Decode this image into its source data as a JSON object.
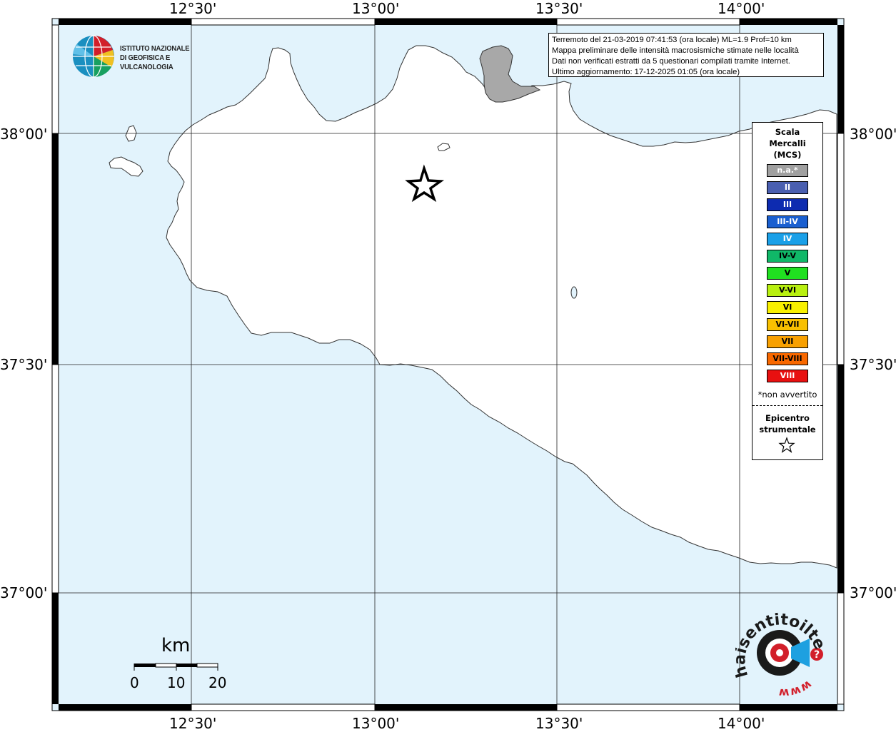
{
  "header": {
    "lines": [
      "Terremoto del 21-03-2019 07:41:53 (ora locale) ML=1.9 Prof=10 km",
      "Mappa preliminare delle intensità macrosismiche stimate nelle località",
      "Dati non verificati estratti da 5 questionari compilati tramite Internet.",
      "Ultimo aggiornamento: 17-12-2025 01:05 (ora locale)"
    ]
  },
  "logo": {
    "line1": "ISTITUTO NAZIONALE",
    "line2": "DI GEOFISICA E VULCANOLOGIA"
  },
  "axes": {
    "lon_labels": [
      "12°30'",
      "13°00'",
      "13°30'",
      "14°00'"
    ],
    "lat_labels": [
      "38°00'",
      "37°30'",
      "37°00'"
    ]
  },
  "legend": {
    "title_line1": "Scala",
    "title_line2": "Mercalli",
    "title_line3": "(MCS)",
    "items": [
      {
        "label": "n.a.*",
        "color": "#a0a0a0",
        "text_color": "#ffffff"
      },
      {
        "label": "II",
        "color": "#4a5fb0",
        "text_color": "#ffffff"
      },
      {
        "label": "III",
        "color": "#0d2bb0",
        "text_color": "#ffffff"
      },
      {
        "label": "III-IV",
        "color": "#1a5fd0",
        "text_color": "#ffffff"
      },
      {
        "label": "IV",
        "color": "#1aa0e8",
        "text_color": "#ffffff"
      },
      {
        "label": "IV-V",
        "color": "#10b868",
        "text_color": "#000000"
      },
      {
        "label": "V",
        "color": "#20e020",
        "text_color": "#000000"
      },
      {
        "label": "V-VI",
        "color": "#b8f010",
        "text_color": "#000000"
      },
      {
        "label": "VI",
        "color": "#f8f000",
        "text_color": "#000000"
      },
      {
        "label": "VI-VII",
        "color": "#f8c000",
        "text_color": "#000000"
      },
      {
        "label": "VII",
        "color": "#f8a000",
        "text_color": "#000000"
      },
      {
        "label": "VII-VIII",
        "color": "#f86800",
        "text_color": "#000000"
      },
      {
        "label": "VIII",
        "color": "#e81010",
        "text_color": "#ffffff"
      }
    ],
    "note": "*non avvertito",
    "epicentre_line1": "Epicentro",
    "epicentre_line2": "strumentale"
  },
  "scale_bar": {
    "unit": "km",
    "ticks": [
      "0",
      "10",
      "20"
    ]
  },
  "badge": {
    "text_top": "haisentitoilterremoto.it",
    "text_bottom": "www.",
    "colors": {
      "red": "#d21f2a",
      "blue": "#1ea0e0",
      "black": "#1a1a1a"
    }
  },
  "colors": {
    "sea": "#e2f3fc",
    "land": "#ffffff",
    "coast": "#333333",
    "frame": "#000000",
    "lampedusa_fill": "#a8a8a8"
  }
}
